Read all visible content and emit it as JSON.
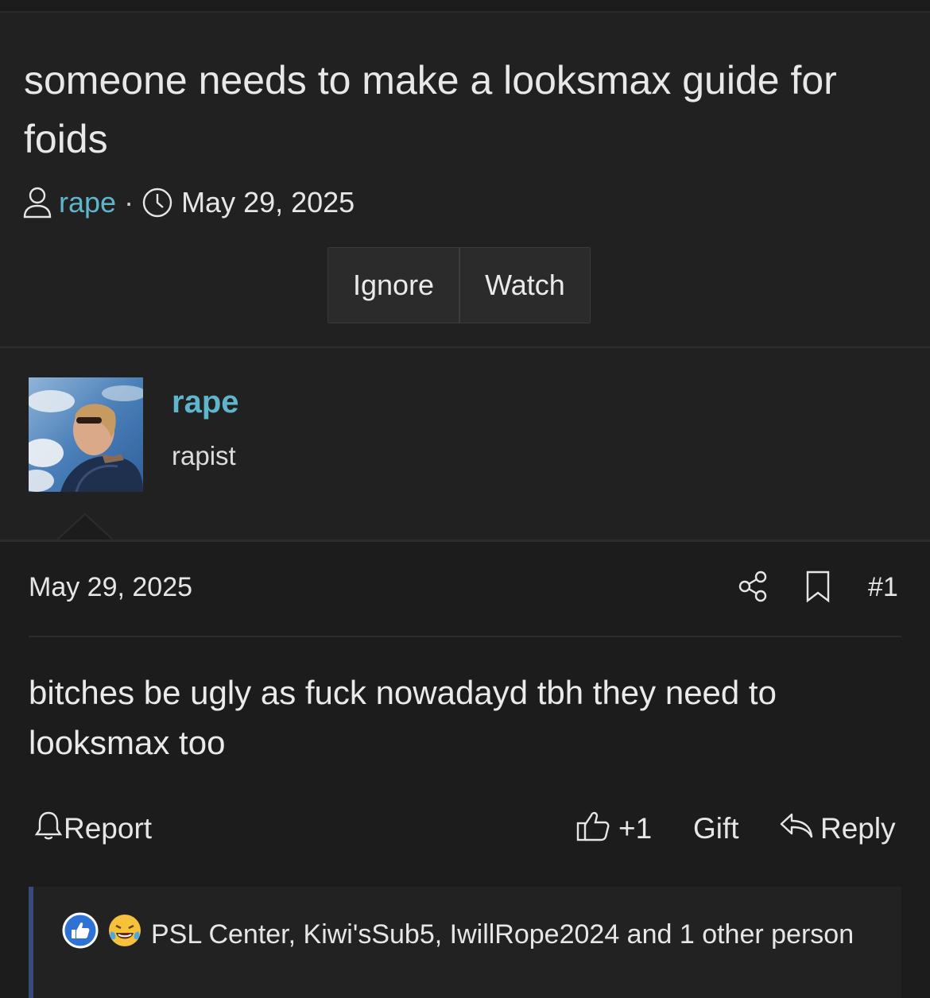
{
  "thread": {
    "title": "someone needs to make a looksmax guide for foids",
    "author": "rape",
    "separator": "·",
    "date": "May 29, 2025",
    "buttons": [
      "Ignore",
      "Watch"
    ]
  },
  "post": {
    "username": "rape",
    "user_title": "rapist",
    "date": "May 29, 2025",
    "number": "#1",
    "body": "bitches be ugly as fuck nowadayd tbh they need to looksmax too",
    "actions": {
      "report": "Report",
      "like_count": "+1",
      "gift": "Gift",
      "reply": "Reply"
    },
    "reactions_text": "PSL Center, Kiwi'sSub5, IwillRope2024 and 1 other person"
  },
  "colors": {
    "link": "#5fb6cc",
    "background": "#1c1c1d",
    "panel": "#212122"
  },
  "icons": [
    "user-icon",
    "clock-icon",
    "share-icon",
    "bookmark-icon",
    "bell-icon",
    "thumbs-up-icon",
    "reply-icon",
    "like-reaction-icon",
    "laughing-crying-reaction-icon"
  ]
}
